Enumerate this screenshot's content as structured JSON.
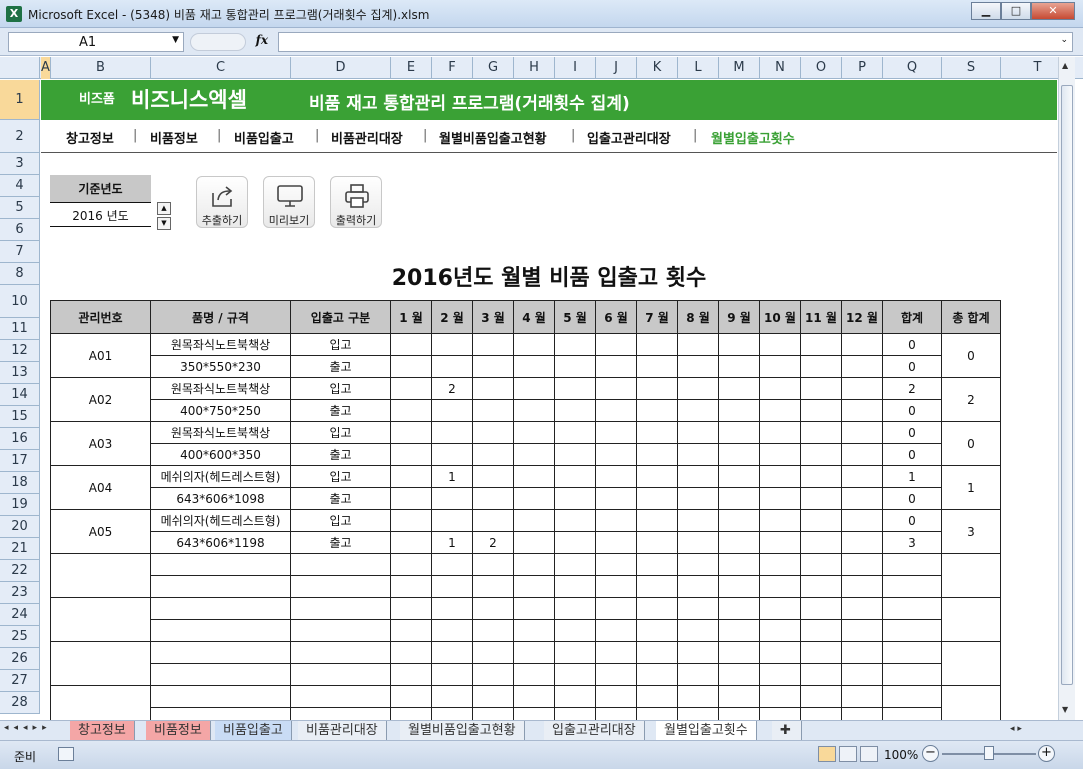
{
  "window": {
    "title": "Microsoft Excel - (5348) 비품 재고 통합관리 프로그램(거래횟수 집계).xlsm",
    "min": "▁",
    "max": "□",
    "close": "✕"
  },
  "formula_bar": {
    "cell_ref": "A1",
    "fx": "fx",
    "value": ""
  },
  "columns": [
    "A",
    "B",
    "C",
    "D",
    "E",
    "F",
    "G",
    "H",
    "I",
    "J",
    "K",
    "L",
    "M",
    "N",
    "O",
    "P",
    "Q",
    "S",
    "T"
  ],
  "rows": [
    "1",
    "2",
    "3",
    "4",
    "5",
    "6",
    "7",
    "8",
    "10",
    "11",
    "12",
    "13",
    "14",
    "15",
    "16",
    "17",
    "18",
    "19",
    "20",
    "21",
    "22",
    "23",
    "24",
    "25",
    "26",
    "27",
    "28"
  ],
  "banner": {
    "brand_small": "비즈폼",
    "brand": "비즈니스엑셀",
    "program": "비품 재고 통합관리 프로그램(거래횟수 집계)"
  },
  "nav": [
    "창고정보",
    "비품정보",
    "비품입출고",
    "비품관리대장",
    "월별비품입출고현황",
    "입출고관리대장",
    "월별입출고횟수"
  ],
  "year_box": {
    "label": "기준년도",
    "value": "2016 년도",
    "up": "▲",
    "down": "▼"
  },
  "tools": {
    "extract": "추출하기",
    "preview": "미리보기",
    "print": "출력하기"
  },
  "report_title": "2016년도 월별 비품 입출고 횟수",
  "table": {
    "headers": [
      "관리번호",
      "품명 / 규격",
      "입출고 구분",
      "1 월",
      "2 월",
      "3 월",
      "4 월",
      "5 월",
      "6 월",
      "7 월",
      "8 월",
      "9 월",
      "10 월",
      "11 월",
      "12 월",
      "합계",
      "총 합계"
    ],
    "items": [
      {
        "id": "A01",
        "name": "원목좌식노트북책상",
        "spec": "350*550*230",
        "in_label": "입고",
        "out_label": "출고",
        "in": [
          "",
          "",
          "",
          "",
          "",
          "",
          "",
          "",
          "",
          "",
          "",
          ""
        ],
        "out": [
          "",
          "",
          "",
          "",
          "",
          "",
          "",
          "",
          "",
          "",
          "",
          ""
        ],
        "in_sum": "0",
        "out_sum": "0",
        "total": "0"
      },
      {
        "id": "A02",
        "name": "원목좌식노트북책상",
        "spec": "400*750*250",
        "in_label": "입고",
        "out_label": "출고",
        "in": [
          "",
          "2",
          "",
          "",
          "",
          "",
          "",
          "",
          "",
          "",
          "",
          ""
        ],
        "out": [
          "",
          "",
          "",
          "",
          "",
          "",
          "",
          "",
          "",
          "",
          "",
          ""
        ],
        "in_sum": "2",
        "out_sum": "0",
        "total": "2"
      },
      {
        "id": "A03",
        "name": "원목좌식노트북책상",
        "spec": "400*600*350",
        "in_label": "입고",
        "out_label": "출고",
        "in": [
          "",
          "",
          "",
          "",
          "",
          "",
          "",
          "",
          "",
          "",
          "",
          ""
        ],
        "out": [
          "",
          "",
          "",
          "",
          "",
          "",
          "",
          "",
          "",
          "",
          "",
          ""
        ],
        "in_sum": "0",
        "out_sum": "0",
        "total": "0"
      },
      {
        "id": "A04",
        "name": "메쉬의자(헤드레스트형)",
        "spec": "643*606*1098",
        "in_label": "입고",
        "out_label": "출고",
        "in": [
          "",
          "1",
          "",
          "",
          "",
          "",
          "",
          "",
          "",
          "",
          "",
          ""
        ],
        "out": [
          "",
          "",
          "",
          "",
          "",
          "",
          "",
          "",
          "",
          "",
          "",
          ""
        ],
        "in_sum": "1",
        "out_sum": "0",
        "total": "1"
      },
      {
        "id": "A05",
        "name": "메쉬의자(헤드레스트형)",
        "spec": "643*606*1198",
        "in_label": "입고",
        "out_label": "출고",
        "in": [
          "",
          "",
          "",
          "",
          "",
          "",
          "",
          "",
          "",
          "",
          "",
          ""
        ],
        "out": [
          "",
          "1",
          "2",
          "",
          "",
          "",
          "",
          "",
          "",
          "",
          "",
          ""
        ],
        "in_sum": "0",
        "out_sum": "3",
        "total": "3"
      },
      {
        "id": "",
        "name": "",
        "spec": "",
        "in_label": "",
        "out_label": "",
        "in": [
          "",
          "",
          "",
          "",
          "",
          "",
          "",
          "",
          "",
          "",
          "",
          ""
        ],
        "out": [
          "",
          "",
          "",
          "",
          "",
          "",
          "",
          "",
          "",
          "",
          "",
          ""
        ],
        "in_sum": "",
        "out_sum": "",
        "total": ""
      },
      {
        "id": "",
        "name": "",
        "spec": "",
        "in_label": "",
        "out_label": "",
        "in": [
          "",
          "",
          "",
          "",
          "",
          "",
          "",
          "",
          "",
          "",
          "",
          ""
        ],
        "out": [
          "",
          "",
          "",
          "",
          "",
          "",
          "",
          "",
          "",
          "",
          "",
          ""
        ],
        "in_sum": "",
        "out_sum": "",
        "total": ""
      },
      {
        "id": "",
        "name": "",
        "spec": "",
        "in_label": "",
        "out_label": "",
        "in": [
          "",
          "",
          "",
          "",
          "",
          "",
          "",
          "",
          "",
          "",
          "",
          ""
        ],
        "out": [
          "",
          "",
          "",
          "",
          "",
          "",
          "",
          "",
          "",
          "",
          "",
          ""
        ],
        "in_sum": "",
        "out_sum": "",
        "total": ""
      },
      {
        "id": "",
        "name": "",
        "spec": "",
        "in_label": "",
        "out_label": "",
        "in": [
          "",
          "",
          "",
          "",
          "",
          "",
          "",
          "",
          "",
          "",
          "",
          ""
        ],
        "out": [
          "",
          "",
          "",
          "",
          "",
          "",
          "",
          "",
          "",
          "",
          "",
          ""
        ],
        "in_sum": "",
        "out_sum": "",
        "total": ""
      }
    ]
  },
  "sheet_tabs": [
    "창고정보",
    "비품정보",
    "비품입출고",
    "비품관리대장",
    "월별비품입출고현황",
    "입출고관리대장",
    "월별입출고횟수"
  ],
  "status": {
    "ready": "준비",
    "zoom": "100%",
    "zoom_out": "−",
    "zoom_in": "+"
  }
}
